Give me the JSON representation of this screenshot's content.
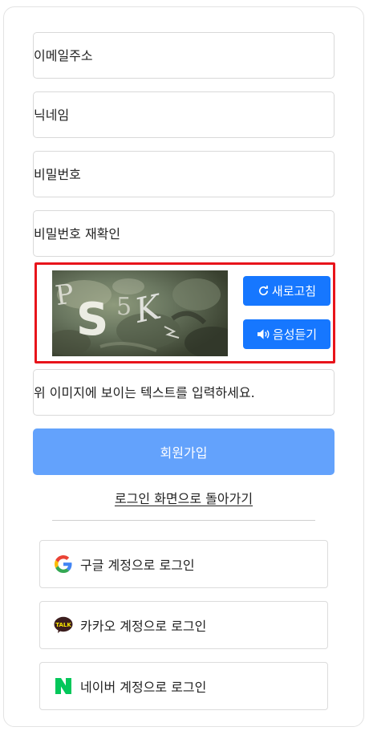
{
  "form": {
    "email_placeholder": "이메일주소",
    "nickname_placeholder": "닉네임",
    "password_placeholder": "비밀번호",
    "password_confirm_placeholder": "비밀번호 재확인",
    "captcha_input_placeholder": "위 이미지에 보이는 텍스트를 입력하세요.",
    "signup_label": "회원가입"
  },
  "captcha": {
    "text": "PS5K",
    "refresh_label": "새로고침",
    "audio_label": "음성듣기"
  },
  "back_link": "로그인 화면으로 돌아가기",
  "social": {
    "google_label": "구글 계정으로 로그인",
    "kakao_label": "카카오 계정으로 로그인",
    "kakao_icon_text": "TALK",
    "naver_label": "네이버 계정으로 로그인"
  },
  "colors": {
    "primary": "#1677ff",
    "signup": "#63a2fc",
    "captcha_border": "#e8141b",
    "naver": "#03c75a",
    "kakao": "#3c1e1e"
  }
}
